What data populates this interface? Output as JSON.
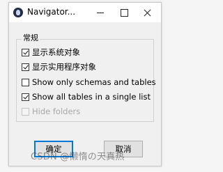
{
  "window": {
    "title": "Navigator...",
    "controls": {
      "minimize_icon": "minimize-icon",
      "maximize_icon": "maximize-icon",
      "close_icon": "close-icon"
    }
  },
  "group": {
    "label": "常规",
    "options": [
      {
        "label": "显示系统对象",
        "checked": true,
        "disabled": false
      },
      {
        "label": "显示实用程序对象",
        "checked": true,
        "disabled": false
      },
      {
        "label": "Show only schemas and tables",
        "checked": false,
        "disabled": false
      },
      {
        "label": "Show all tables in a single list",
        "checked": true,
        "disabled": false
      },
      {
        "label": "Hide folders",
        "checked": false,
        "disabled": true
      }
    ]
  },
  "buttons": {
    "ok_label": "确定",
    "cancel_label": "取消"
  },
  "watermark": "CSDN @懒惰の天真热",
  "colors": {
    "focus_accent": "#0078d7",
    "dialog_bg": "#f0f0f0",
    "disabled_text": "#a8a8a8"
  }
}
